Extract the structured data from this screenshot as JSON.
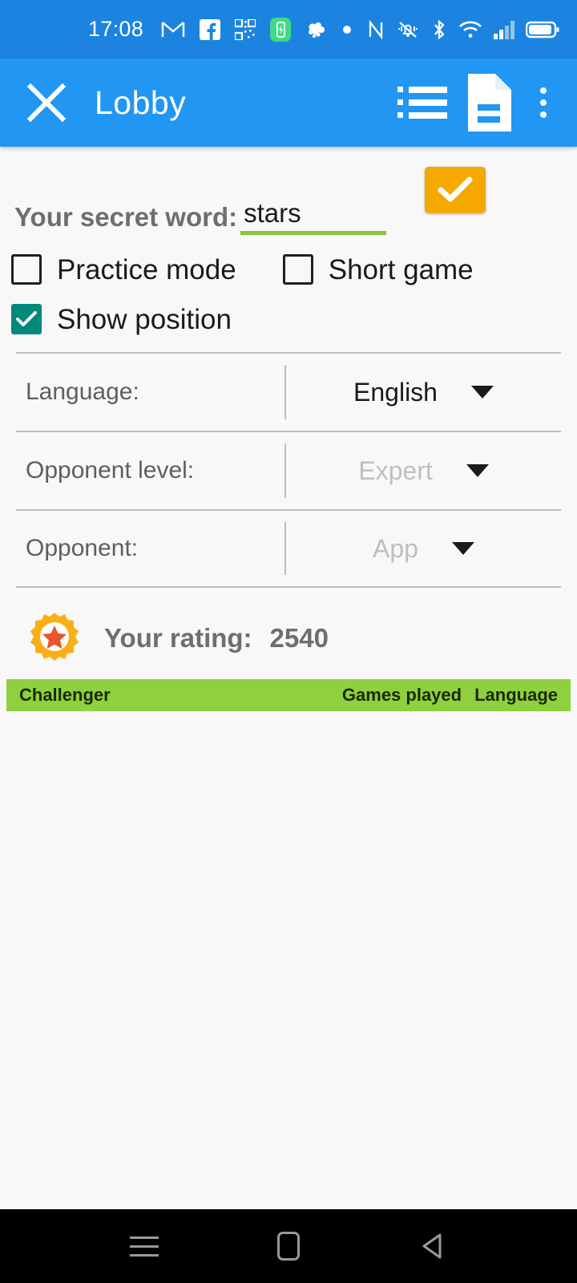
{
  "status_bar": {
    "time": "17:08",
    "left_icons": [
      "gmail-icon",
      "facebook-icon",
      "qr-code-icon",
      "battery-app-icon",
      "cloud-icon",
      "dot-icon"
    ],
    "right_icons": [
      "nfc-icon",
      "vibrate-off-icon",
      "bluetooth-icon",
      "wifi-icon",
      "cell-signal-icon",
      "battery-icon"
    ],
    "background_color": "#1C84E0"
  },
  "app_bar": {
    "title": "Lobby",
    "close_icon": "close-icon",
    "list_icon": "list-icon",
    "document_icon": "document-icon",
    "overflow_icon": "overflow-menu-icon",
    "background_color": "#2196F3"
  },
  "secret_word": {
    "label": "Your secret word:",
    "value": "stars",
    "placeholder": "",
    "underline_color": "#8CC63F",
    "confirm_icon": "checkmark-icon",
    "confirm_color": "#F5A800"
  },
  "options": [
    {
      "label": "Practice mode",
      "checked": false
    },
    {
      "label": "Short game",
      "checked": false
    },
    {
      "label": "Show position",
      "checked": true
    }
  ],
  "settings": [
    {
      "label": "Language:",
      "value": "English",
      "disabled": false
    },
    {
      "label": "Opponent level:",
      "value": "Expert",
      "disabled": true
    },
    {
      "label": "Opponent:",
      "value": "App",
      "disabled": true
    }
  ],
  "rating": {
    "icon": "rosette-award-icon",
    "label": "Your rating:",
    "value": "2540"
  },
  "challenger_table": {
    "header_color": "#8FD03F",
    "columns": [
      "Challenger",
      "Games played",
      "Language"
    ],
    "rows": []
  },
  "nav_bar": {
    "recent_icon": "recent-apps-icon",
    "home_icon": "home-icon",
    "back_icon": "back-icon",
    "background_color": "#000000"
  }
}
